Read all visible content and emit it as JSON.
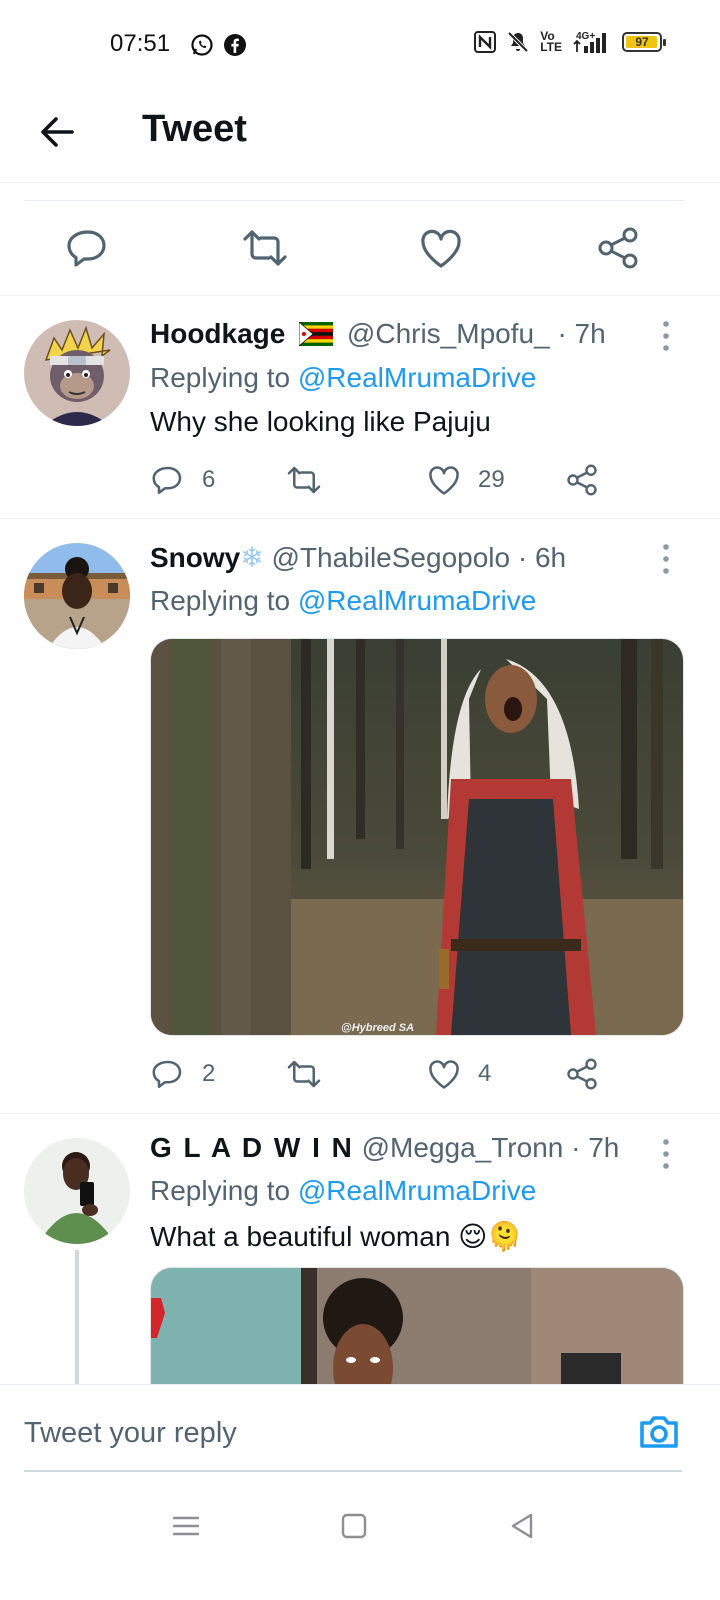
{
  "status_bar": {
    "time": "07:51",
    "indicators": [
      "nfc-icon",
      "mute-icon",
      "volte-icon",
      "signal-4g-icon"
    ],
    "volte_text": "Vo\nLTE",
    "battery": "97"
  },
  "header": {
    "title": "Tweet"
  },
  "tweets": [
    {
      "name": "Hoodkage",
      "flag": "zimbabwe-flag-icon",
      "handle": "@Chris_Mpofu_",
      "time": "· 7h",
      "replying_prefix": "Replying to",
      "replying_to": "@RealMrumaDrive",
      "text": "Why she looking like Pajuju",
      "replies": "6",
      "retweets": "",
      "likes": "29"
    },
    {
      "name": "Snowy",
      "name_emoji": "❄",
      "handle": "@ThabileSegopolo",
      "time": "· 6h",
      "replying_prefix": "Replying to",
      "replying_to": "@RealMrumaDrive",
      "media_watermark": "@Hybreed SA",
      "replies": "2",
      "retweets": "",
      "likes": "4"
    },
    {
      "name": "G L A D W I N",
      "handle": "@Megga_Tronn",
      "time": "· 7h",
      "replying_prefix": "Replying to",
      "replying_to": "@RealMrumaDrive",
      "text": "What a beautiful woman",
      "text_emojis": "😌🫠"
    }
  ],
  "reply_bar": {
    "placeholder": "Tweet your reply"
  },
  "colors": {
    "accent": "#1d9bf0",
    "secondary_text": "#536471",
    "primary_text": "#0f1419"
  }
}
